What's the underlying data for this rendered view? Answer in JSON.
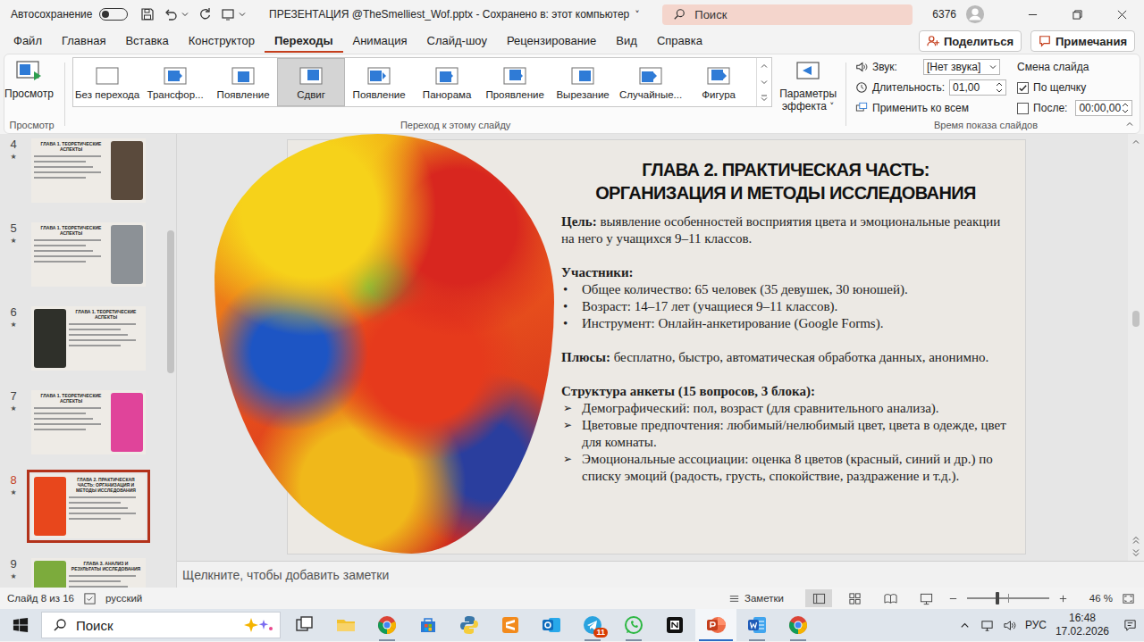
{
  "title_bar": {
    "autosave_label": "Автосохранение",
    "autosave_on": false,
    "title": "ПРЕЗЕНТАЦИЯ @TheSmelliest_Wof.pptx - Сохранено в: этот компьютер",
    "title_caret": "˅",
    "search_placeholder": "Поиск",
    "user_count": "6376"
  },
  "menu_tabs": [
    {
      "label": "Файл",
      "selected": false
    },
    {
      "label": "Главная",
      "selected": false
    },
    {
      "label": "Вставка",
      "selected": false
    },
    {
      "label": "Конструктор",
      "selected": false
    },
    {
      "label": "Переходы",
      "selected": true
    },
    {
      "label": "Анимация",
      "selected": false
    },
    {
      "label": "Слайд-шоу",
      "selected": false
    },
    {
      "label": "Рецензирование",
      "selected": false
    },
    {
      "label": "Вид",
      "selected": false
    },
    {
      "label": "Справка",
      "selected": false
    }
  ],
  "share_button": "Поделиться",
  "comments_button": "Примечания",
  "ribbon": {
    "preview": {
      "label": "Просмотр",
      "group": "Просмотр"
    },
    "transitions": {
      "group": "Переход к этому слайду",
      "items": [
        {
          "label": "Без перехода",
          "selected": false
        },
        {
          "label": "Трансфор...",
          "selected": false
        },
        {
          "label": "Появление",
          "selected": false
        },
        {
          "label": "Сдвиг",
          "selected": true
        },
        {
          "label": "Появление",
          "selected": false
        },
        {
          "label": "Панорама",
          "selected": false
        },
        {
          "label": "Проявление",
          "selected": false
        },
        {
          "label": "Вырезание",
          "selected": false
        },
        {
          "label": "Случайные...",
          "selected": false
        },
        {
          "label": "Фигура",
          "selected": false
        }
      ],
      "effect_options": "Параметры эффекта",
      "effect_caret": "˅"
    },
    "timing": {
      "group": "Время показа слайдов",
      "sound_label": "Звук:",
      "sound_value": "[Нет звука]",
      "duration_label": "Длительность:",
      "duration_value": "01,00",
      "apply_all": "Применить ко всем",
      "advance_title": "Смена слайда",
      "on_click": {
        "label": "По щелчку",
        "checked": true
      },
      "after": {
        "label": "После:",
        "checked": false,
        "value": "00:00,00"
      }
    }
  },
  "slides_pane": {
    "marker": "★",
    "thumbnails": [
      {
        "number": "4",
        "title": "ГЛАВА 1. ТЕОРЕТИЧЕСКИЕ АСПЕКТЫ",
        "selected": false,
        "kind": "picture-right",
        "color": "#5a4a3c"
      },
      {
        "number": "5",
        "title": "ГЛАВА 1. ТЕОРЕТИЧЕСКИЕ АСПЕКТЫ",
        "selected": false,
        "kind": "picture-right",
        "color": "#8c9196"
      },
      {
        "number": "6",
        "title": "ГЛАВА 1. ТЕОРЕТИЧЕСКИЕ АСПЕКТЫ",
        "selected": false,
        "kind": "picture-left",
        "color": "#2f302a"
      },
      {
        "number": "7",
        "title": "ГЛАВА 1. ТЕОРЕТИЧЕСКИЕ АСПЕКТЫ",
        "selected": false,
        "kind": "picture-right",
        "color": "#e0449a"
      },
      {
        "number": "8",
        "title": "ГЛАВА 2. ПРАКТИЧЕСКАЯ ЧАСТЬ: ОРГАНИЗАЦИЯ И МЕТОДЫ ИССЛЕДОВАНИЯ",
        "selected": true,
        "kind": "picture-left",
        "color": "#e8471c"
      },
      {
        "number": "9",
        "title": "ГЛАВА 3. АНАЛИЗ И РЕЗУЛЬТАТЫ ИССЛЕДОВАНИЯ",
        "selected": false,
        "kind": "picture-left",
        "color": "#7cab3c"
      }
    ]
  },
  "slide": {
    "title_lines": [
      "ГЛАВА 2. ПРАКТИЧЕСКАЯ ЧАСТЬ:",
      "ОРГАНИЗАЦИЯ И МЕТОДЫ ИССЛЕДОВАНИЯ"
    ],
    "goal_label": "Цель:",
    "goal_text": "выявление особенностей восприятия цвета и эмоциональные реакции на него у учащихся 9–11 классов.",
    "participants_title": "Участники:",
    "bullet": "•",
    "participants": [
      "Общее количество: 65 человек (35 девушек, 30 юношей).",
      "Возраст: 14–17 лет (учащиеся 9–11 классов).",
      "Инструмент: Онлайн-анкетирование (Google Forms)."
    ],
    "pros_label": "Плюсы:",
    "pros_text": "бесплатно, быстро, автоматическая обработка данных, анонимно.",
    "structure_title": "Структура анкеты (15 вопросов, 3 блока):",
    "arrow": "➢",
    "structure": [
      "Демографический: пол, возраст (для сравнительного анализа).",
      "Цветовые предпочтения: любимый/нелюбимый цвет, цвета в одежде, цвет для комнаты.",
      "Эмоциональные ассоциации: оценка 8 цветов (красный, синий и др.) по списку эмоций (радость, грусть, спокойствие, раздражение и т.д.)."
    ]
  },
  "notes_placeholder": "Щелкните, чтобы добавить заметки",
  "status_bar": {
    "slide_info": "Слайд 8 из 16",
    "language": "русский",
    "notes": "Заметки",
    "zoom": "46 %",
    "zoom_level": 0.37
  },
  "taskbar": {
    "search": "Поиск",
    "apps": [
      {
        "kind": "task-view",
        "color": "#333333",
        "running": false,
        "active": false,
        "badge": ""
      },
      {
        "kind": "explorer",
        "color": "#f2c12e",
        "running": false,
        "active": false,
        "badge": ""
      },
      {
        "kind": "chrome",
        "color": "#4285f4",
        "running": true,
        "active": false,
        "badge": ""
      },
      {
        "kind": "store",
        "color": "#2b79d6",
        "running": false,
        "active": false,
        "badge": ""
      },
      {
        "kind": "python",
        "color": "#3a77a8",
        "running": false,
        "active": false,
        "badge": ""
      },
      {
        "kind": "sublime",
        "color": "#f28a1c",
        "running": false,
        "active": false,
        "badge": ""
      },
      {
        "kind": "outlook",
        "color": "#0f6cbd",
        "running": false,
        "active": false,
        "badge": ""
      },
      {
        "kind": "telegram",
        "color": "#2aa3df",
        "running": true,
        "active": false,
        "badge": "11"
      },
      {
        "kind": "whatsapp",
        "color": "#2bb741",
        "running": true,
        "active": false,
        "badge": ""
      },
      {
        "kind": "notion",
        "color": "#111111",
        "running": false,
        "active": false,
        "badge": ""
      },
      {
        "kind": "powerpoint",
        "color": "#c43e1c",
        "running": true,
        "active": true,
        "badge": ""
      },
      {
        "kind": "word",
        "color": "#1f5bb8",
        "running": true,
        "active": false,
        "badge": ""
      },
      {
        "kind": "chrome",
        "color": "#4285f4",
        "running": true,
        "active": false,
        "badge": ""
      }
    ],
    "language": "РУС",
    "time": "16:48",
    "date": "17.02.2026"
  }
}
